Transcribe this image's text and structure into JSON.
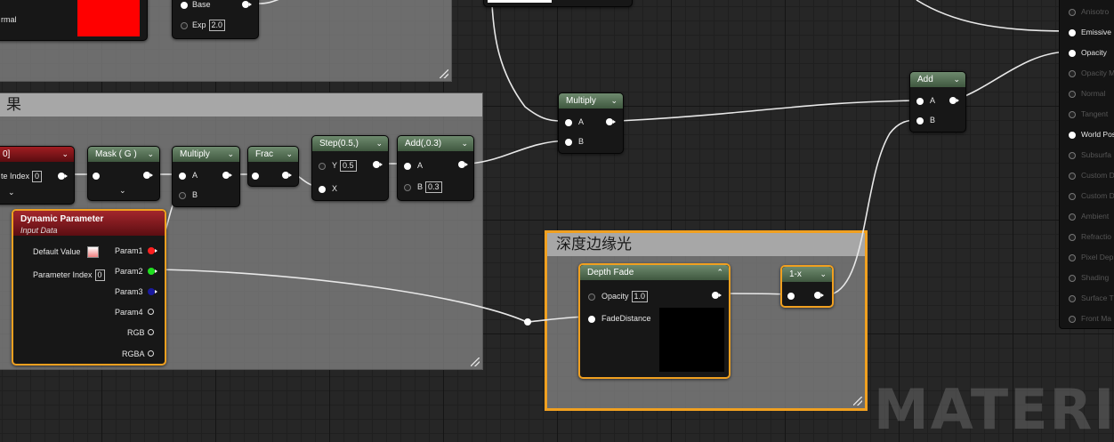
{
  "watermark": "MATERIAL",
  "top_left_node": {
    "label": "rmal"
  },
  "base_node": {
    "base": "Base",
    "exp": "Exp",
    "exp_value": "2.0"
  },
  "comment_left": {
    "title": "果"
  },
  "comment_depth": {
    "title": "深度边缘光"
  },
  "left_cut_node": {
    "title": "0]",
    "index_label": "te Index",
    "index_value": "0"
  },
  "mask_node": {
    "title": "Mask ( G )"
  },
  "multiply_inner": {
    "title": "Multiply",
    "a": "A",
    "b": "B"
  },
  "frac_node": {
    "title": "Frac"
  },
  "step_node": {
    "title": "Step(0.5,)",
    "y": "Y",
    "y_value": "0.5",
    "x": "X"
  },
  "add03_node": {
    "title": "Add(,0.3)",
    "a": "A",
    "b": "B",
    "b_value": "0.3"
  },
  "multiply_outer": {
    "title": "Multiply",
    "a": "A",
    "b": "B"
  },
  "add_node": {
    "title": "Add",
    "a": "A",
    "b": "B"
  },
  "dynamic_param": {
    "title": "Dynamic Parameter",
    "subtitle": "Input Data",
    "default_value": "Default Value",
    "param_index": "Parameter Index",
    "param_index_value": "0",
    "outputs": [
      "Param1",
      "Param2",
      "Param3",
      "Param4",
      "RGB",
      "RGBA"
    ]
  },
  "depth_fade": {
    "title": "Depth Fade",
    "opacity": "Opacity",
    "opacity_value": "1.0",
    "fade_distance": "FadeDistance"
  },
  "one_minus": {
    "title": "1-x"
  },
  "material_pins": [
    {
      "label": "Anisotro",
      "active": false
    },
    {
      "label": "Emissive",
      "active": true
    },
    {
      "label": "Opacity",
      "active": true
    },
    {
      "label": "Opacity M",
      "active": false
    },
    {
      "label": "Normal",
      "active": false
    },
    {
      "label": "Tangent",
      "active": false
    },
    {
      "label": "World Pos",
      "active": true
    },
    {
      "label": "Subsurfa",
      "active": false
    },
    {
      "label": "Custom D",
      "active": false
    },
    {
      "label": "Custom D",
      "active": false
    },
    {
      "label": "Ambient",
      "active": false
    },
    {
      "label": "Refractio",
      "active": false
    },
    {
      "label": "Pixel Dep",
      "active": false
    },
    {
      "label": "Shading",
      "active": false
    },
    {
      "label": "Surface T",
      "active": false
    },
    {
      "label": "Front Ma",
      "active": false
    }
  ],
  "colors": {
    "accent": "#f0a020",
    "param1": "#ff2020",
    "param2": "#20e020",
    "param3": "#1a1aa0",
    "swatch_red": "#ff0000"
  }
}
